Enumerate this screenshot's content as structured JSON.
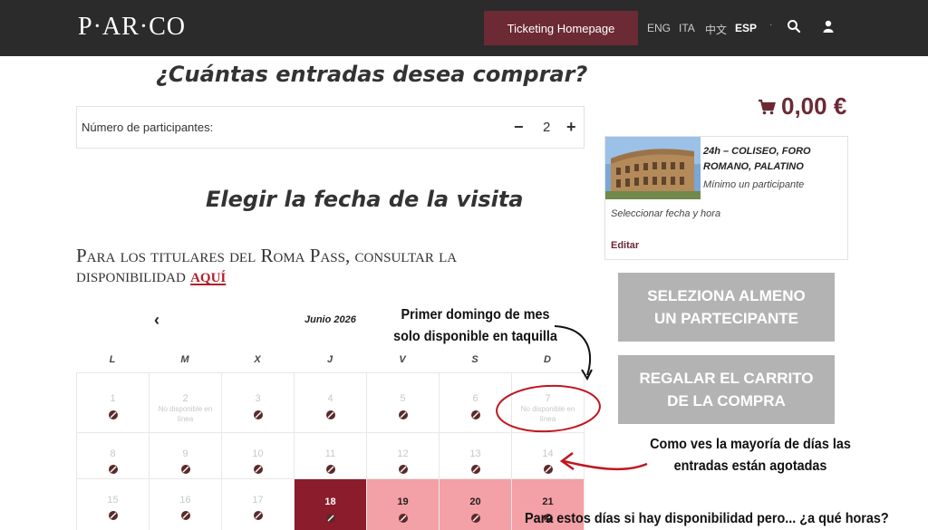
{
  "header": {
    "logo": "P·AR·CO",
    "ticketing_label": "Ticketing Homepage",
    "languages": [
      "ENG",
      "ITA",
      "中文",
      "ESP"
    ],
    "active_language": "ESP",
    "icons": [
      "search-icon",
      "user-icon"
    ]
  },
  "quantity": {
    "heading": "¿Cuántas entradas desea comprar?",
    "label": "Número de participantes:",
    "minus": "−",
    "value": "2",
    "plus": "+"
  },
  "date": {
    "heading": "Elegir la fecha de la visita",
    "romapass_text": "Para los titulares del Roma Pass, consultar la disponibilidad",
    "romapass_link": "aquí"
  },
  "calendar": {
    "prev": "‹",
    "month": "Junio 2026",
    "weekdays": [
      "L",
      "M",
      "X",
      "J",
      "V",
      "S",
      "D"
    ],
    "rows": [
      [
        {
          "day": "1",
          "state": "soldout"
        },
        {
          "day": "2",
          "state": "offline",
          "note": "No disponible en línea"
        },
        {
          "day": "3",
          "state": "soldout"
        },
        {
          "day": "4",
          "state": "soldout"
        },
        {
          "day": "5",
          "state": "soldout"
        },
        {
          "day": "6",
          "state": "soldout"
        },
        {
          "day": "7",
          "state": "offline",
          "note": "No disponible en línea"
        }
      ],
      [
        {
          "day": "8",
          "state": "soldout"
        },
        {
          "day": "9",
          "state": "soldout"
        },
        {
          "day": "10",
          "state": "soldout"
        },
        {
          "day": "11",
          "state": "soldout"
        },
        {
          "day": "12",
          "state": "soldout"
        },
        {
          "day": "13",
          "state": "soldout"
        },
        {
          "day": "14",
          "state": "soldout"
        }
      ],
      [
        {
          "day": "15",
          "state": "soldout"
        },
        {
          "day": "16",
          "state": "soldout"
        },
        {
          "day": "17",
          "state": "soldout"
        },
        {
          "day": "18",
          "state": "selected"
        },
        {
          "day": "19",
          "state": "available"
        },
        {
          "day": "20",
          "state": "available"
        },
        {
          "day": "21",
          "state": "available"
        }
      ]
    ]
  },
  "cart": {
    "total": "0,00 €",
    "item_title": "24h – COLISEO, FORO ROMANO, PALATINO",
    "item_min": "Mínimo un participante",
    "item_select": "Seleccionar fecha y hora",
    "edit_label": "Editar",
    "btn_select": "SELEZIONA ALMENO UN PARTECIPANTE",
    "btn_gift": "REGALAR EL CARRITO DE LA COMPRA"
  },
  "annotations": {
    "sunday": "Primer domingo de mes solo disponible en taquilla",
    "soldout": "Como ves la mayoría de días las entradas están agotadas",
    "available": "Para estos días si hay disponibilidad pero... ¿a qué horas?"
  },
  "colors": {
    "header_bg": "#2b2b2b",
    "brand": "#6b2a34",
    "selected_day": "#8b1c2b",
    "highlight_days": "#f3a0a6",
    "annotation_red": "#c0161f",
    "disabled_button": "#b3b3b3"
  }
}
